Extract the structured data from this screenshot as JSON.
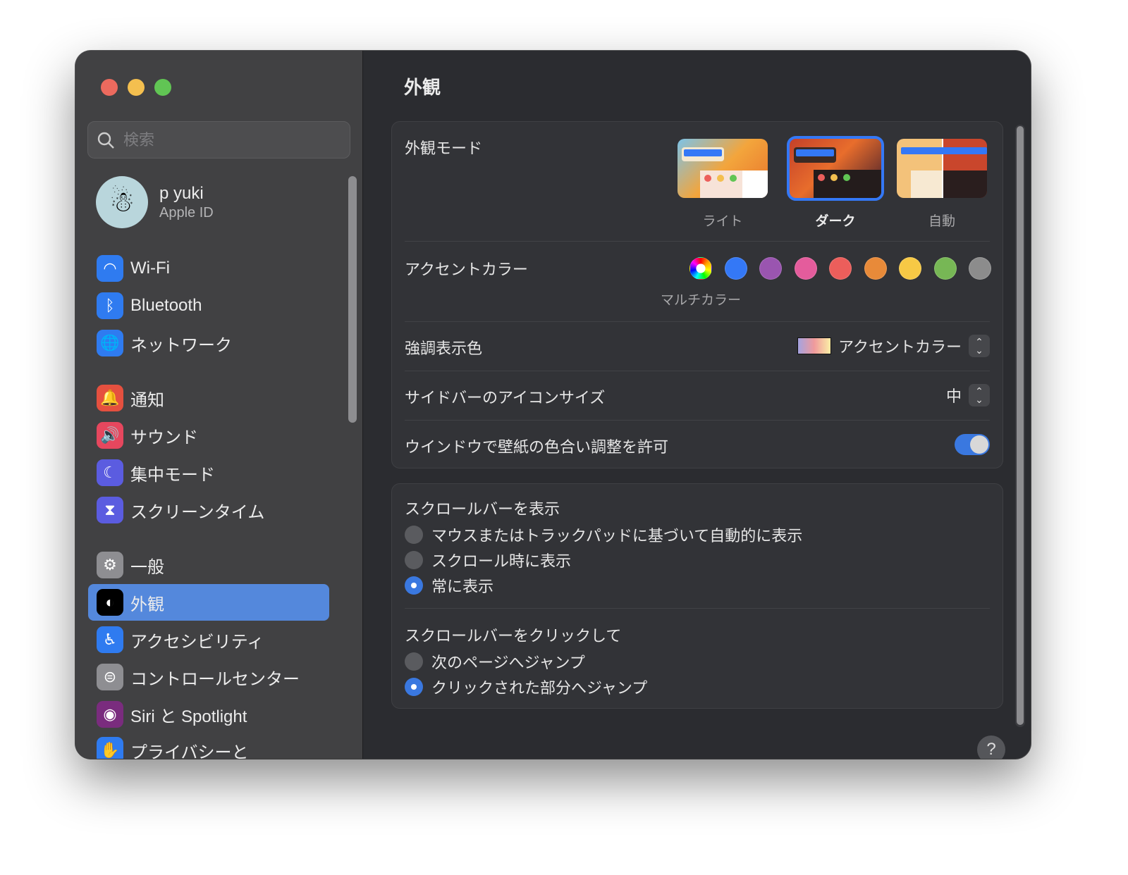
{
  "search": {
    "placeholder": "検索"
  },
  "profile": {
    "name": "p yuki",
    "subtitle": "Apple ID"
  },
  "sidebar": {
    "items": [
      {
        "label": "Wi-Fi",
        "icon": "wifi-icon",
        "color": "#2f7bf0"
      },
      {
        "label": "Bluetooth",
        "icon": "bluetooth-icon",
        "color": "#2f7bf0"
      },
      {
        "label": "ネットワーク",
        "icon": "globe-icon",
        "color": "#2f7bf0"
      },
      {
        "label": "通知",
        "icon": "bell-icon",
        "color": "#e5503f"
      },
      {
        "label": "サウンド",
        "icon": "speaker-icon",
        "color": "#e6475e"
      },
      {
        "label": "集中モード",
        "icon": "moon-icon",
        "color": "#5b5ce0"
      },
      {
        "label": "スクリーンタイム",
        "icon": "hourglass-icon",
        "color": "#5b5ce0"
      },
      {
        "label": "一般",
        "icon": "gear-icon",
        "color": "#8e8e92"
      },
      {
        "label": "外観",
        "icon": "appearance-icon",
        "color": "#000000",
        "selected": true
      },
      {
        "label": "アクセシビリティ",
        "icon": "accessibility-icon",
        "color": "#2f7bf0"
      },
      {
        "label": "コントロールセンター",
        "icon": "toggles-icon",
        "color": "#8e8e92"
      },
      {
        "label": "Siri と Spotlight",
        "icon": "siri-icon",
        "color": "#7a2c7e"
      },
      {
        "label": "プライバシーと",
        "icon": "hand-icon",
        "color": "#2f7bf0"
      }
    ]
  },
  "main": {
    "title": "外観",
    "appearance_mode": {
      "label": "外観モード",
      "options": [
        "ライト",
        "ダーク",
        "自動"
      ],
      "selected": "ダーク"
    },
    "accent_color": {
      "label": "アクセントカラー",
      "selected_caption": "マルチカラー",
      "colors": [
        "multicolor",
        "#3478f6",
        "#9a55b0",
        "#e45c9c",
        "#ec5e5b",
        "#e88a39",
        "#f7c945",
        "#77b755",
        "#8c8c8c"
      ]
    },
    "highlight_color": {
      "label": "強調表示色",
      "value": "アクセントカラー"
    },
    "sidebar_icon_size": {
      "label": "サイドバーのアイコンサイズ",
      "value": "中"
    },
    "wallpaper_tinting": {
      "label": "ウインドウで壁紙の色合い調整を許可",
      "enabled": true
    },
    "show_scrollbars": {
      "label": "スクロールバーを表示",
      "options": [
        "マウスまたはトラックパッドに基づいて自動的に表示",
        "スクロール時に表示",
        "常に表示"
      ],
      "selected": "常に表示"
    },
    "click_scrollbar": {
      "label": "スクロールバーをクリックして",
      "options": [
        "次のページへジャンプ",
        "クリックされた部分へジャンプ"
      ],
      "selected": "クリックされた部分へジャンプ"
    },
    "help": "?"
  }
}
